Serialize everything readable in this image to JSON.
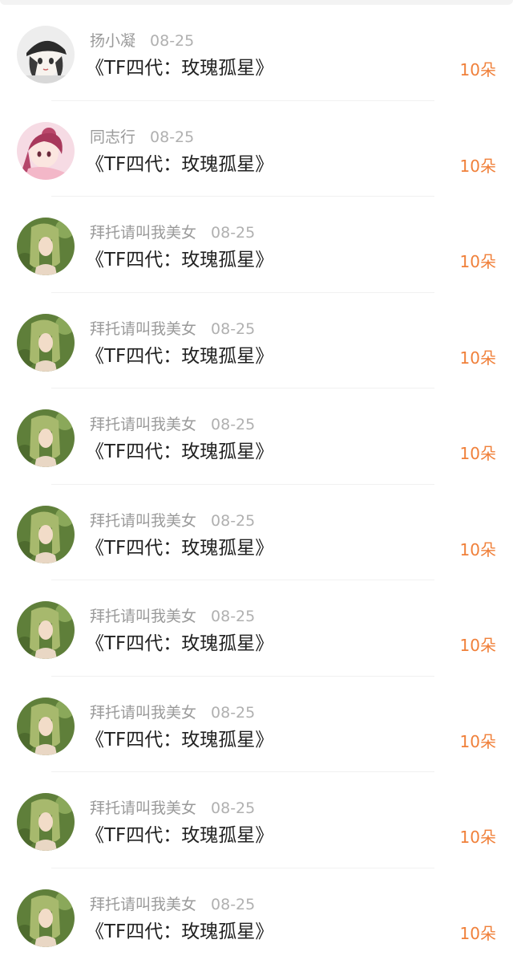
{
  "gift_list": {
    "items": [
      {
        "user": "扬小凝",
        "date": "08-25",
        "title": "《TF四代：玫瑰孤星》",
        "amount": "10朵",
        "avatar_icon": "anime-boy-cap-avatar"
      },
      {
        "user": "同志行",
        "date": "08-25",
        "title": "《TF四代：玫瑰孤星》",
        "amount": "10朵",
        "avatar_icon": "anime-girl-pink-avatar"
      },
      {
        "user": "拜托请叫我美女",
        "date": "08-25",
        "title": "《TF四代：玫瑰孤星》",
        "amount": "10朵",
        "avatar_icon": "green-hair-girl-avatar"
      },
      {
        "user": "拜托请叫我美女",
        "date": "08-25",
        "title": "《TF四代：玫瑰孤星》",
        "amount": "10朵",
        "avatar_icon": "green-hair-girl-avatar"
      },
      {
        "user": "拜托请叫我美女",
        "date": "08-25",
        "title": "《TF四代：玫瑰孤星》",
        "amount": "10朵",
        "avatar_icon": "green-hair-girl-avatar"
      },
      {
        "user": "拜托请叫我美女",
        "date": "08-25",
        "title": "《TF四代：玫瑰孤星》",
        "amount": "10朵",
        "avatar_icon": "green-hair-girl-avatar"
      },
      {
        "user": "拜托请叫我美女",
        "date": "08-25",
        "title": "《TF四代：玫瑰孤星》",
        "amount": "10朵",
        "avatar_icon": "green-hair-girl-avatar"
      },
      {
        "user": "拜托请叫我美女",
        "date": "08-25",
        "title": "《TF四代：玫瑰孤星》",
        "amount": "10朵",
        "avatar_icon": "green-hair-girl-avatar"
      },
      {
        "user": "拜托请叫我美女",
        "date": "08-25",
        "title": "《TF四代：玫瑰孤星》",
        "amount": "10朵",
        "avatar_icon": "green-hair-girl-avatar"
      },
      {
        "user": "拜托请叫我美女",
        "date": "08-25",
        "title": "《TF四代：玫瑰孤星》",
        "amount": "10朵",
        "avatar_icon": "green-hair-girl-avatar"
      }
    ]
  },
  "colors": {
    "amount": "#f0803a",
    "username": "#9a9a9a",
    "title": "#222222"
  }
}
